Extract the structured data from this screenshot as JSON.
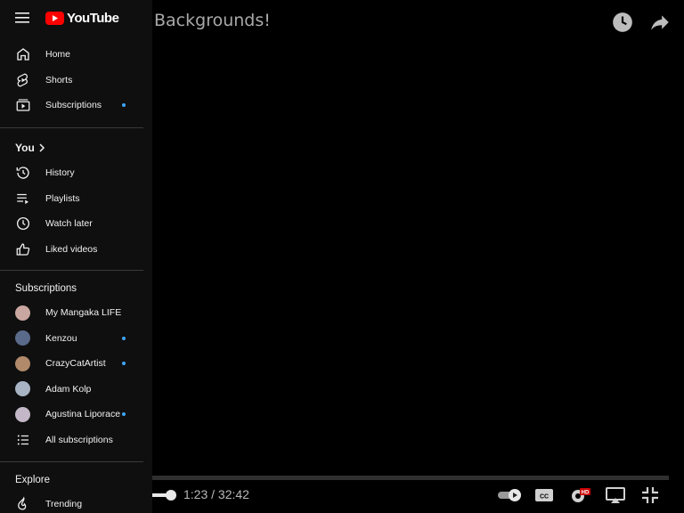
{
  "video": {
    "title": "Backgrounds!",
    "time": "1:23 / 32:42"
  },
  "sidebar": {
    "logo": "YouTube",
    "main": [
      {
        "label": "Home",
        "icon": "home-icon"
      },
      {
        "label": "Shorts",
        "icon": "shorts-icon"
      },
      {
        "label": "Subscriptions",
        "icon": "subscriptions-icon",
        "dot": true
      }
    ],
    "you": {
      "title": "You",
      "items": [
        {
          "label": "History",
          "icon": "history-icon"
        },
        {
          "label": "Playlists",
          "icon": "playlists-icon"
        },
        {
          "label": "Watch later",
          "icon": "clock-icon"
        },
        {
          "label": "Liked videos",
          "icon": "thumbs-up-icon"
        }
      ]
    },
    "subscriptions": {
      "title": "Subscriptions",
      "channels": [
        {
          "label": "My Mangaka LIFE",
          "dot": false,
          "color": "#c9a7a0"
        },
        {
          "label": "Kenzou",
          "dot": true,
          "color": "#5a6a8a"
        },
        {
          "label": "CrazyCatArtist",
          "dot": true,
          "color": "#b08a6a"
        },
        {
          "label": "Adam Kolp",
          "dot": false,
          "color": "#a8b4c4"
        },
        {
          "label": "Agustina Liporace",
          "dot": true,
          "color": "#c4b8c8"
        }
      ],
      "all_label": "All subscriptions"
    },
    "explore": {
      "title": "Explore",
      "items": [
        {
          "label": "Trending",
          "icon": "trending-icon"
        }
      ]
    }
  },
  "colors": {
    "brand": "#ff0000",
    "dot": "#3ea6ff",
    "sidebar_bg": "#0f0f0f"
  }
}
